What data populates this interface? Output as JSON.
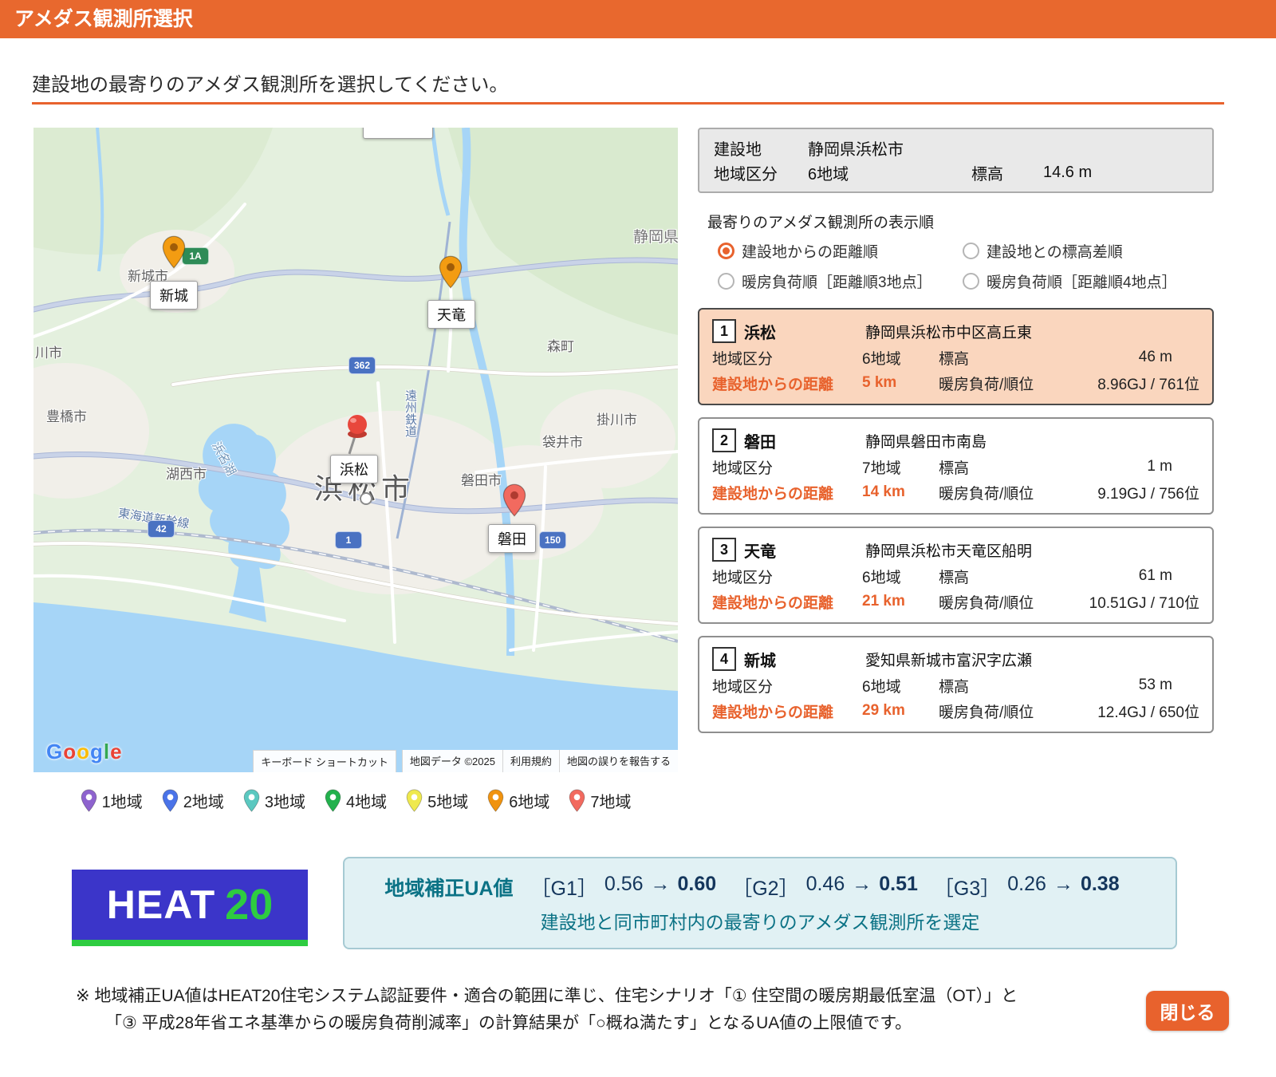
{
  "header": {
    "title": "アメダス観測所選択"
  },
  "instruction": "建設地の最寄りのアメダス観測所を選択してください。",
  "site": {
    "label": "建設地",
    "value": "静岡県浜松市",
    "region_label": "地域区分",
    "region": "6地域",
    "elevation_label": "標高",
    "elevation": "14.6 m"
  },
  "sort": {
    "title": "最寄りのアメダス観測所の表示順",
    "options": [
      {
        "label": "建設地からの距離順",
        "selected": true
      },
      {
        "label": "建設地との標高差順",
        "selected": false
      },
      {
        "label": "暖房負荷順［距離順3地点］",
        "selected": false
      },
      {
        "label": "暖房負荷順［距離順4地点］",
        "selected": false
      }
    ]
  },
  "field_labels": {
    "region": "地域区分",
    "elevation": "標高",
    "distance": "建設地からの距離",
    "load": "暖房負荷/順位"
  },
  "stations": [
    {
      "rank": "1",
      "name": "浜松",
      "address": "静岡県浜松市中区高丘東",
      "region": "6地域",
      "elevation": "46 m",
      "distance": "5 km",
      "load": "8.96GJ / 761位"
    },
    {
      "rank": "2",
      "name": "磐田",
      "address": "静岡県磐田市南島",
      "region": "7地域",
      "elevation": "1 m",
      "distance": "14 km",
      "load": "9.19GJ / 756位"
    },
    {
      "rank": "3",
      "name": "天竜",
      "address": "静岡県浜松市天竜区船明",
      "region": "6地域",
      "elevation": "61 m",
      "distance": "21 km",
      "load": "10.51GJ / 710位"
    },
    {
      "rank": "4",
      "name": "新城",
      "address": "愛知県新城市富沢字広瀬",
      "region": "6地域",
      "elevation": "53 m",
      "distance": "29 km",
      "load": "12.4GJ / 650位"
    }
  ],
  "map": {
    "labels": [
      {
        "text": "静岡県"
      },
      {
        "text": "新城市"
      },
      {
        "text": "森町"
      },
      {
        "text": "掛川市"
      },
      {
        "text": "袋井市"
      },
      {
        "text": "磐田市"
      },
      {
        "text": "湖西市"
      },
      {
        "text": "豊橋市"
      },
      {
        "text": "川市"
      },
      {
        "text": "浜松市"
      },
      {
        "text": "浜名湖"
      },
      {
        "text": "東海道新幹線"
      },
      {
        "text": "遠州鉄道"
      }
    ],
    "shields": [
      {
        "text": "1A",
        "color": "#2E8B57"
      },
      {
        "text": "362",
        "color": "#4A72C2"
      },
      {
        "text": "42",
        "color": "#4A72C2"
      },
      {
        "text": "1",
        "color": "#4A72C2"
      },
      {
        "text": "150",
        "color": "#4A72C2"
      }
    ],
    "markers": [
      {
        "label": "新城",
        "color": "#F39C12"
      },
      {
        "label": "天竜",
        "color": "#F39C12"
      },
      {
        "label": "浜松",
        "color": "#E8473C"
      },
      {
        "label": "磐田",
        "color": "#F26A5F"
      }
    ],
    "google_letters": [
      {
        "ch": "G",
        "color": "#4285F4"
      },
      {
        "ch": "o",
        "color": "#EA4335"
      },
      {
        "ch": "o",
        "color": "#FBBC05"
      },
      {
        "ch": "g",
        "color": "#4285F4"
      },
      {
        "ch": "l",
        "color": "#34A853"
      },
      {
        "ch": "e",
        "color": "#EA4335"
      }
    ],
    "attribution": [
      {
        "text": "キーボード ショートカット"
      },
      {
        "text": "地図データ ©2025"
      },
      {
        "text": "利用規約"
      },
      {
        "text": "地図の誤りを報告する"
      }
    ]
  },
  "legend": [
    {
      "label": "1地域",
      "color": "#8E63CE"
    },
    {
      "label": "2地域",
      "color": "#4A73E8"
    },
    {
      "label": "3地域",
      "color": "#5BC8C0"
    },
    {
      "label": "4地域",
      "color": "#23B14D"
    },
    {
      "label": "5地域",
      "color": "#EFE94E"
    },
    {
      "label": "6地域",
      "color": "#F0930F"
    },
    {
      "label": "7地域",
      "color": "#F26A5F"
    }
  ],
  "heat20": {
    "heat": "HEAT",
    "twenty": "20"
  },
  "ua": {
    "label": "地域補正UA値",
    "items": [
      {
        "grade": "［G1］",
        "from": "0.56",
        "arrow": "→",
        "to": "0.60"
      },
      {
        "grade": "［G2］",
        "from": "0.46",
        "arrow": "→",
        "to": "0.51"
      },
      {
        "grade": "［G3］",
        "from": "0.26",
        "arrow": "→",
        "to": "0.38"
      }
    ],
    "note": "建設地と同市町村内の最寄りのアメダス観測所を選定"
  },
  "footnote": {
    "line1": "※ 地域補正UA値はHEAT20住宅システム認証要件・適合の範囲に準じ、住宅シナリオ「① 住空間の暖房期最低室温（OT）」と",
    "line2": "「③ 平成28年省エネ基準からの暖房負荷削減率」の計算結果が「○概ね満たす」となるUA値の上限値です。"
  },
  "close_button": "閉じる"
}
